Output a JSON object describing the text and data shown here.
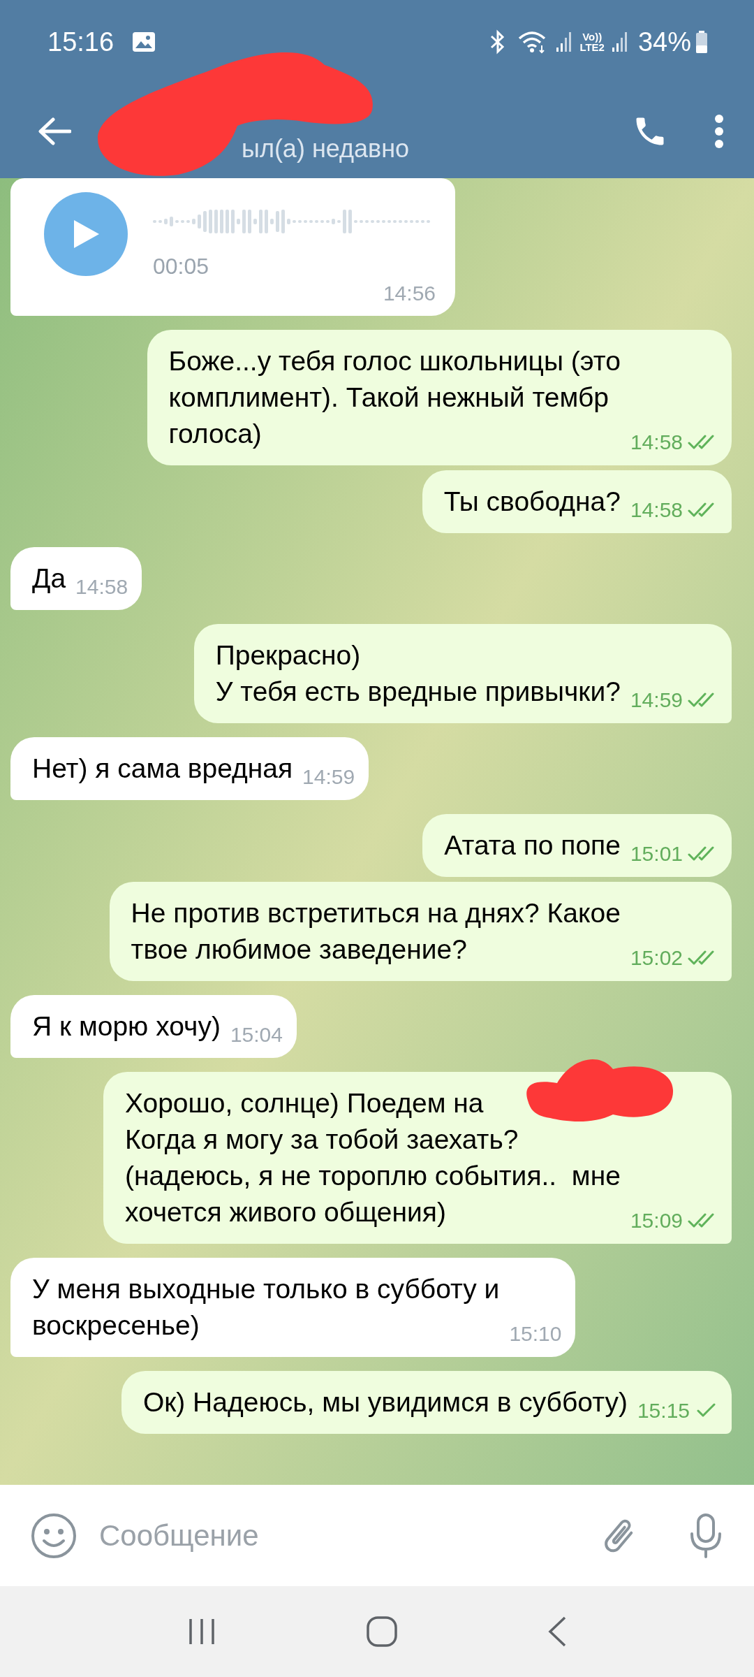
{
  "status_bar": {
    "time": "15:16",
    "volte_top": "Vo))",
    "volte_bottom": "LTE2",
    "battery": "34%"
  },
  "header": {
    "name_redacted": true,
    "subtitle": "ыл(а) недавно"
  },
  "messages": [
    {
      "kind": "voice",
      "outgoing": false,
      "duration": "00:05",
      "time": "14:56"
    },
    {
      "kind": "text",
      "outgoing": true,
      "text": "Боже...у тебя голос школьницы (это\nкомплимент). Такой нежный тембр\nголоса)",
      "time": "14:58",
      "read": true
    },
    {
      "kind": "text",
      "outgoing": true,
      "text": "Ты свободна?",
      "time": "14:58",
      "read": true
    },
    {
      "kind": "text",
      "outgoing": false,
      "text": "Да",
      "time": "14:58"
    },
    {
      "kind": "text",
      "outgoing": true,
      "text": "Прекрасно)\nУ тебя есть вредные привычки?",
      "time": "14:59",
      "read": true
    },
    {
      "kind": "text",
      "outgoing": false,
      "text": "Нет) я сама вредная",
      "time": "14:59"
    },
    {
      "kind": "text",
      "outgoing": true,
      "text": "Атата по попе",
      "time": "15:01",
      "read": true
    },
    {
      "kind": "text",
      "outgoing": true,
      "text": "Не против встретиться на днях? Какое\nтвое любимое заведение?",
      "time": "15:02",
      "read": true
    },
    {
      "kind": "text",
      "outgoing": false,
      "text": "Я к морю хочу)",
      "time": "15:04"
    },
    {
      "kind": "text",
      "outgoing": true,
      "text": "Хорошо, солнце) Поедем на\nКогда я могу за тобой заехать?\n(надеюсь, я не тороплю события..  мне\nхочется живого общения)",
      "time": "15:09",
      "read": true,
      "redacted": true
    },
    {
      "kind": "text",
      "outgoing": false,
      "text": "У меня выходные только в субботу и\nвоскресенье)",
      "time": "15:10"
    },
    {
      "kind": "text",
      "outgoing": true,
      "text": "Ок) Надеюсь, мы увидимся в субботу)",
      "time": "15:15",
      "read": false
    }
  ],
  "composer": {
    "placeholder": "Сообщение"
  }
}
